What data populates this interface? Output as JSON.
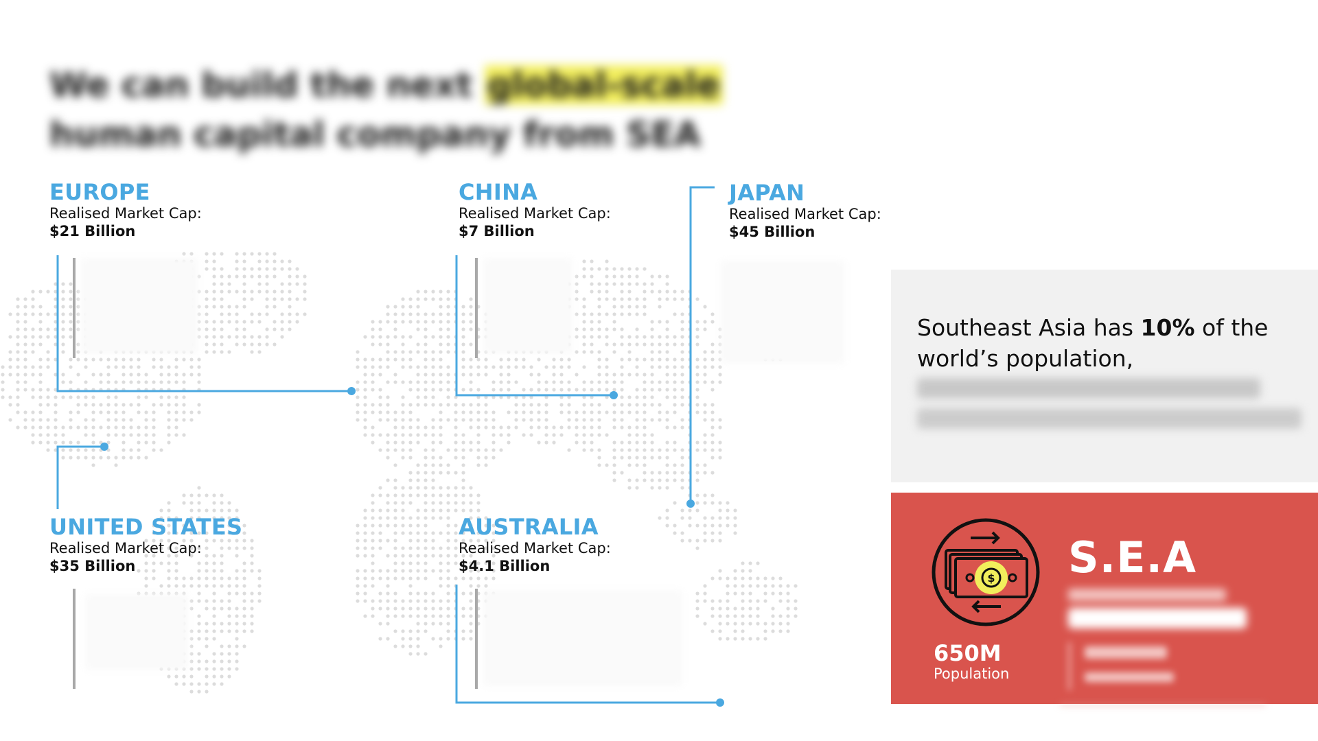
{
  "headline": {
    "line1_pre": "We can build the next ",
    "line1_highlight": "global-scale",
    "line2": "human capital company from SEA"
  },
  "regions": [
    {
      "id": "europe",
      "name": "EUROPE",
      "cap_label": "Realised Market Cap:",
      "cap_value": "$21 Billion"
    },
    {
      "id": "china",
      "name": "CHINA",
      "cap_label": "Realised Market Cap:",
      "cap_value": "$7 Billion"
    },
    {
      "id": "japan",
      "name": "JAPAN",
      "cap_label": "Realised Market Cap:",
      "cap_value": "$45 Billion"
    },
    {
      "id": "united_states",
      "name": "UNITED STATES",
      "cap_label": "Realised Market Cap:",
      "cap_value": "$35 Billion"
    },
    {
      "id": "australia",
      "name": "AUSTRALIA",
      "cap_label": "Realised Market Cap:",
      "cap_value": "$4.1 Billion"
    }
  ],
  "info": {
    "text_pre": "Southeast Asia has ",
    "text_bold": "10%",
    "text_post": " of the world’s population,"
  },
  "sea": {
    "title": "S.E.A",
    "population_value": "650M",
    "population_label": "Population"
  },
  "colors": {
    "accent_blue": "#4aa8e0",
    "sea_red": "#d9544d",
    "panel_grey": "#f1f1f1",
    "highlight_yellow": "#f2ee5c",
    "dot_grey": "#dcdcdc"
  },
  "icons": {
    "sea_icon": "money-exchange-icon"
  }
}
